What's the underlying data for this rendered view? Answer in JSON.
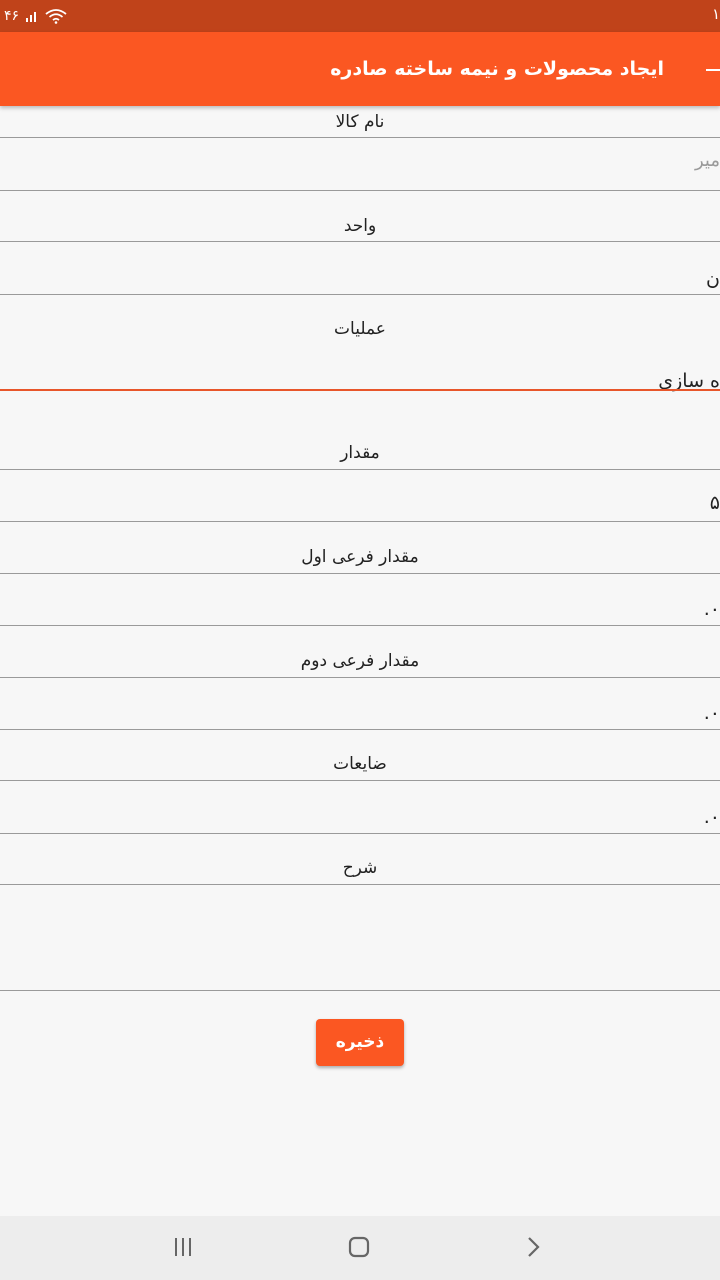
{
  "status_bar": {
    "left_fragment": "۴۶",
    "right_fragment": "۱"
  },
  "app_bar": {
    "title": "ایجاد محصولات و نیمه ساخته صادره",
    "back_icon": "back-arrow-icon"
  },
  "form": {
    "item_name": {
      "label": "نام کالا",
      "placeholder": "میر"
    },
    "unit": {
      "label": "واحد",
      "value": "ن"
    },
    "operations": {
      "label": "عملیات",
      "value": "ه  سازی"
    },
    "amount": {
      "label": "مقدار",
      "value": "۵"
    },
    "sub_amount_1": {
      "label": "مقدار فرعی اول",
      "value": ".۰"
    },
    "sub_amount_2": {
      "label": "مقدار فرعی دوم",
      "value": ".۰"
    },
    "waste": {
      "label": "ضایعات",
      "value": ".۰"
    },
    "description": {
      "label": "شرح",
      "value": ""
    }
  },
  "save_button": {
    "label": "ذخیره"
  },
  "nav_bar": {
    "recent_icon": "recent-apps-icon",
    "home_icon": "home-icon",
    "back_icon": "nav-back-icon"
  },
  "colors": {
    "status_bar": "#c0431a",
    "app_bar": "#fb5722",
    "accent_line": "#e8562a",
    "background": "#f7f7f7"
  }
}
